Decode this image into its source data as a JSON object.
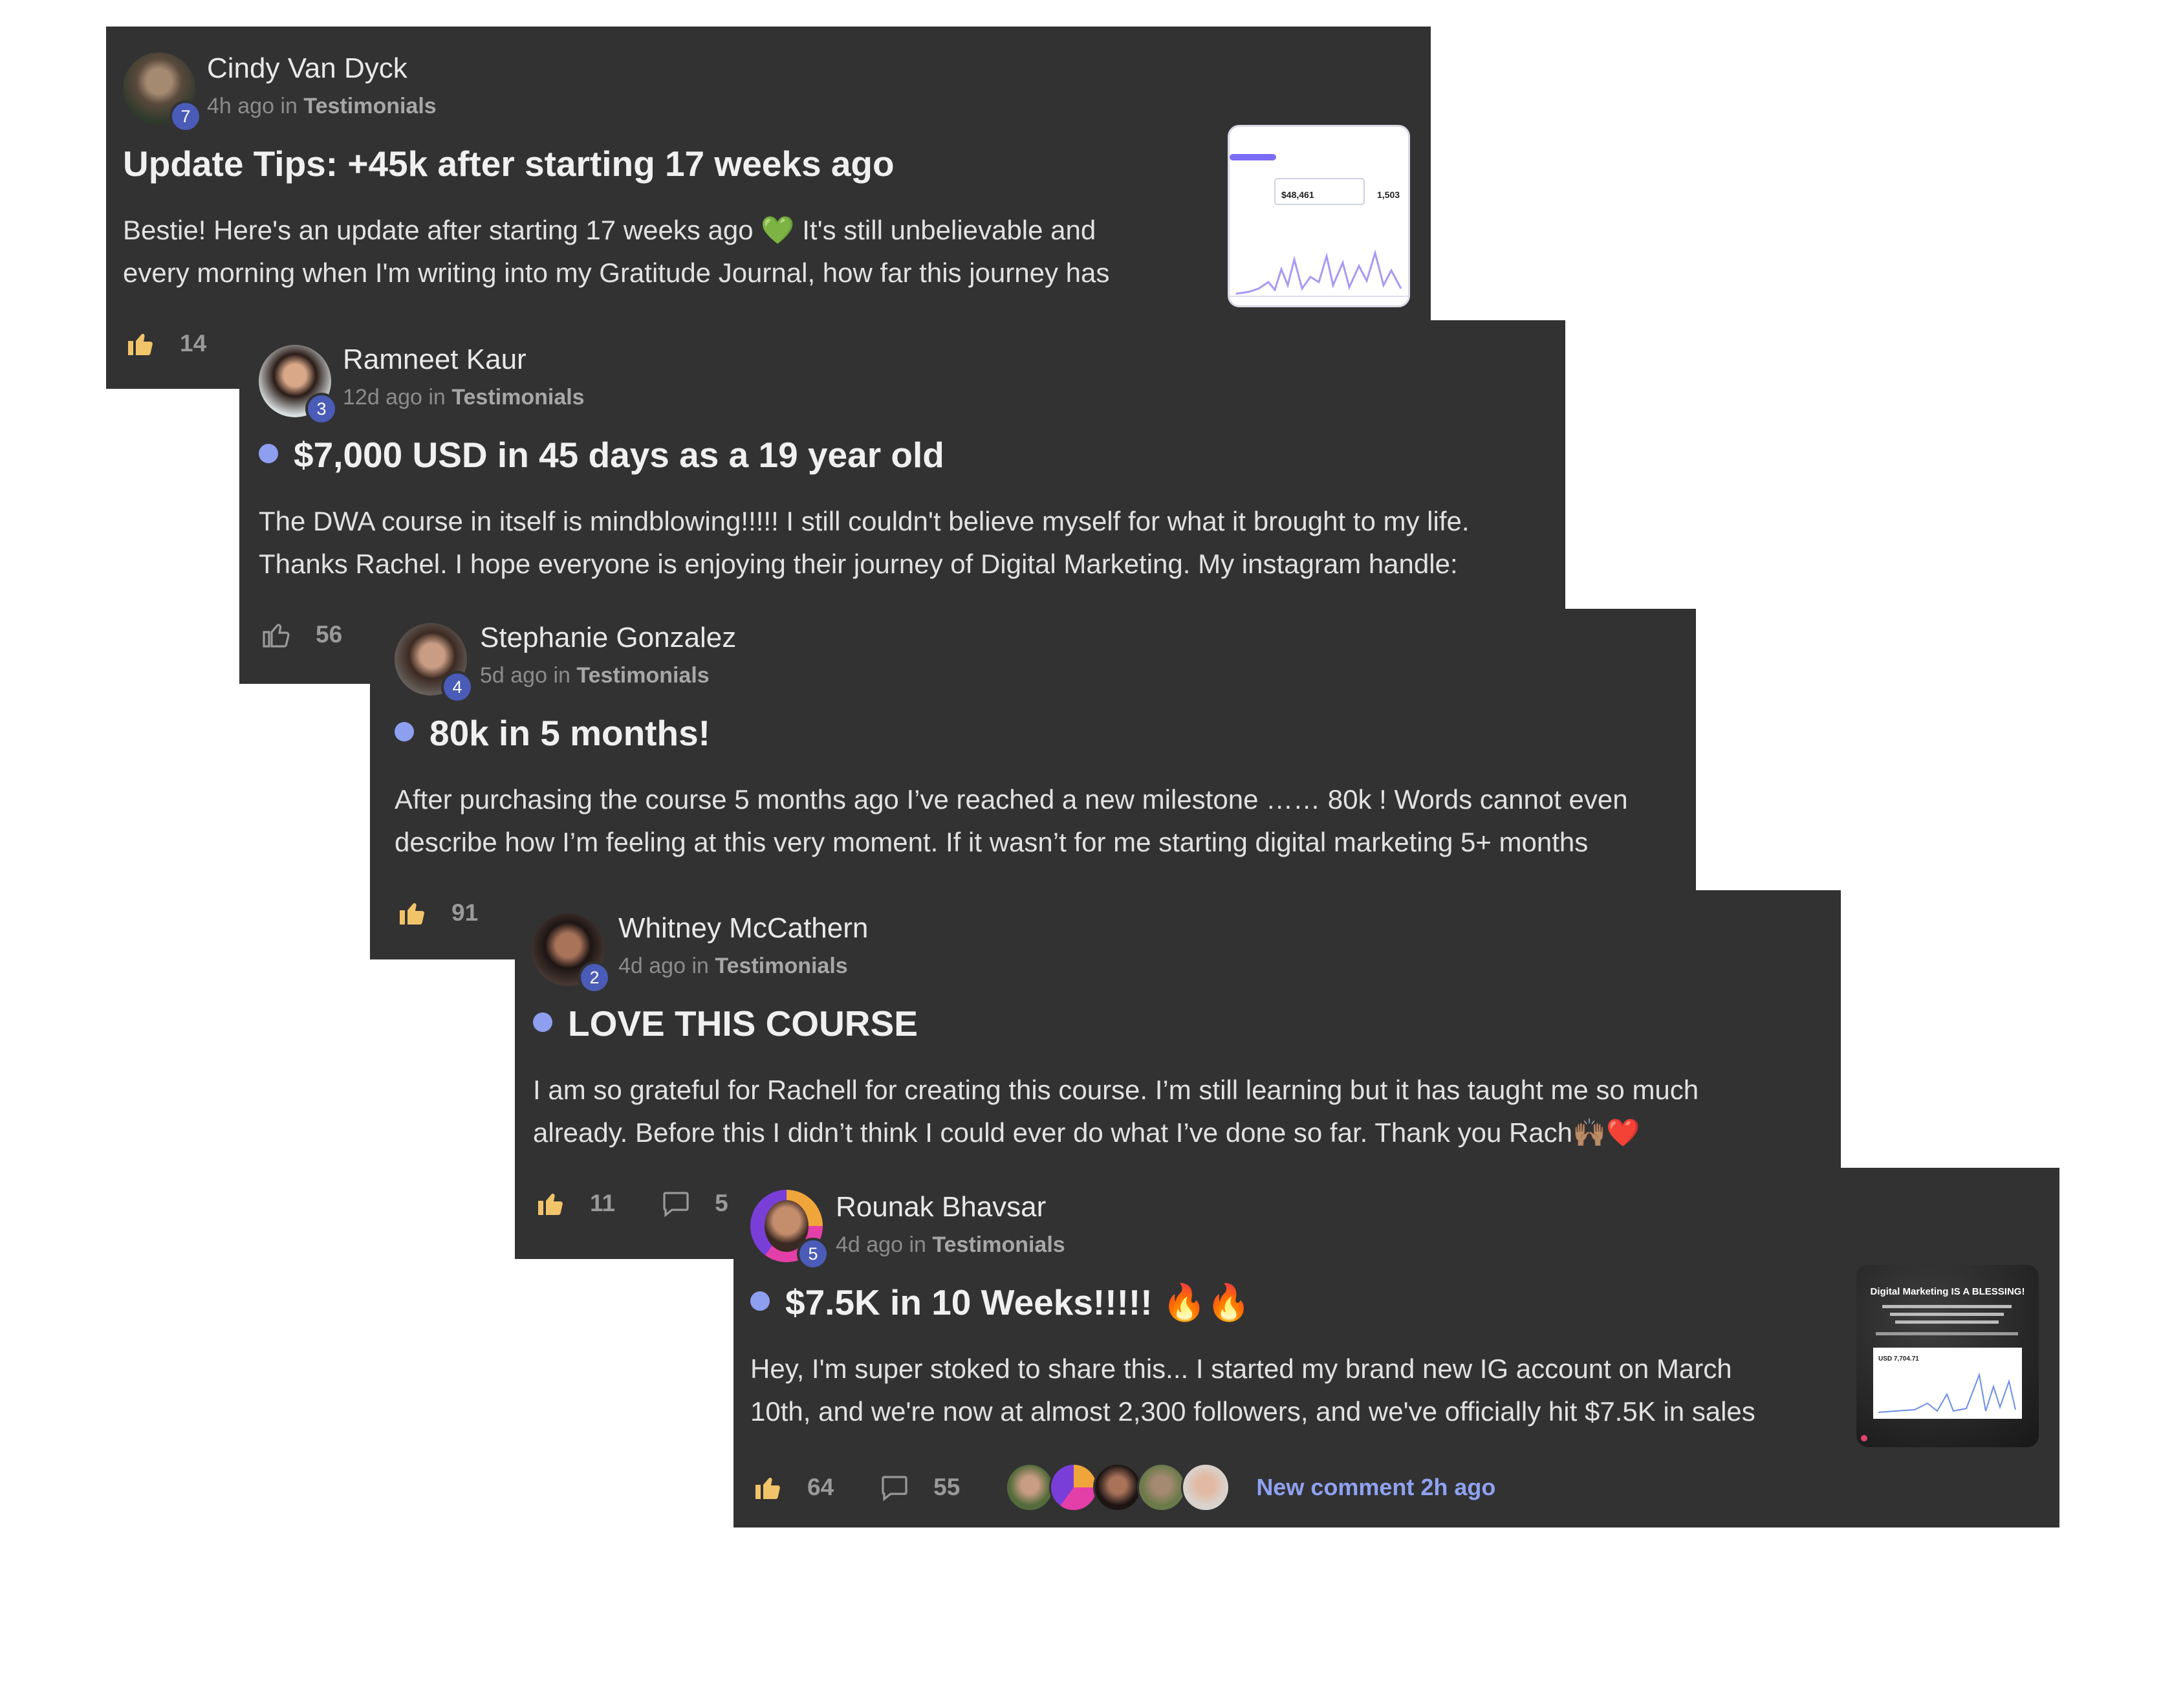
{
  "posts": [
    {
      "author": "Cindy Van Dyck",
      "level": "7",
      "time": "4h ago",
      "in_word": "in",
      "space": "Testimonials",
      "title": "Update Tips: +45k after starting 17 weeks ago",
      "body_line1": "Bestie! Here's an update after starting 17 weeks ago 💚 It's still unbelievable and",
      "body_line2": "every morning when I'm writing into my Gratitude Journal, how far this journey has",
      "likes": "14",
      "thumb_value1": "$48,461",
      "thumb_value2": "1,503"
    },
    {
      "author": "Ramneet Kaur",
      "level": "3",
      "time": "12d ago",
      "in_word": "in",
      "space": "Testimonials",
      "title": "$7,000 USD in 45 days as a 19 year old",
      "body_line1": "The DWA course in itself is mindblowing!!!!! I still couldn't believe myself for what it brought to my life.",
      "body_line2": "Thanks Rachel. I hope everyone is enjoying their journey of Digital Marketing. My instagram handle:",
      "likes": "56"
    },
    {
      "author": "Stephanie Gonzalez",
      "level": "4",
      "time": "5d ago",
      "in_word": "in",
      "space": "Testimonials",
      "title": "80k in 5 months!",
      "body_line1": "After purchasing the course 5 months ago I’ve reached a new milestone …… 80k ! Words cannot even",
      "body_line2": "describe how I’m feeling at this very moment. If it wasn’t for me starting digital marketing 5+ months",
      "likes": "91"
    },
    {
      "author": "Whitney McCathern",
      "level": "2",
      "time": "4d ago",
      "in_word": "in",
      "space": "Testimonials",
      "title": "LOVE THIS COURSE",
      "body_line1": "I am so grateful for Rachell for creating this course. I’m still learning but it has taught me so much",
      "body_line2": "already. Before this I didn’t think I could ever do what I’ve done so far. Thank you Rach🙌🏽❤️",
      "likes": "11",
      "comments": "5"
    },
    {
      "author": "Rounak Bhavsar",
      "level": "5",
      "time": "4d ago",
      "in_word": "in",
      "space": "Testimonials",
      "title": "$7.5K in 10 Weeks!!!!! 🔥🔥",
      "body_line1": "Hey, I'm super stoked to share this... I started my brand new IG account on March",
      "body_line2": "10th, and we're now at almost 2,300 followers, and we've officially hit $7.5K in sales",
      "likes": "64",
      "comments": "55",
      "new_comment": "New comment 2h ago",
      "thumb_heading": "Digital Marketing IS A BLESSING!",
      "thumb_value": "USD 7,704.71"
    }
  ],
  "colors": {
    "card_bg": "#323233",
    "accent_dot": "#8e9ff0",
    "level_badge": "#4a5bb8",
    "like_filled": "#f2c46a",
    "link": "#8fa2f2"
  },
  "icons": [
    "thumbs-up-icon",
    "comment-icon"
  ]
}
